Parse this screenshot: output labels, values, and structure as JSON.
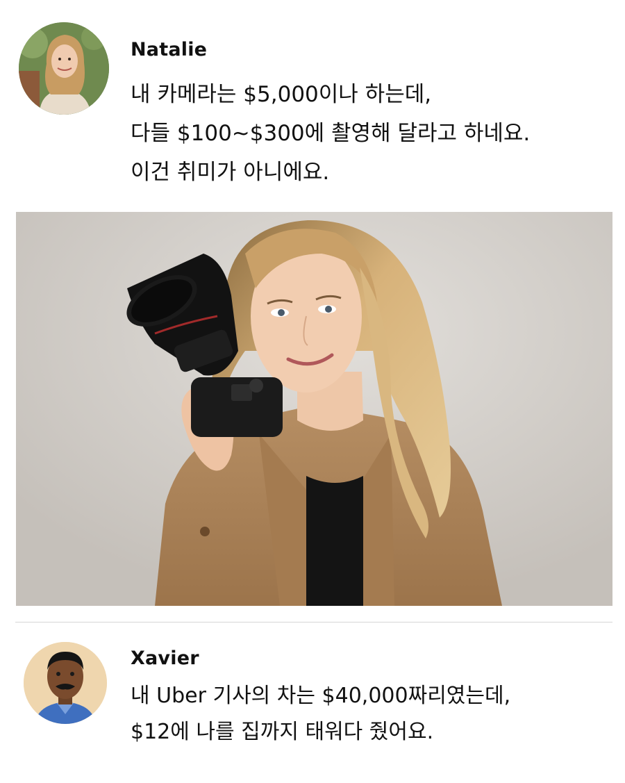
{
  "posts": [
    {
      "author": "Natalie",
      "avatar_icon": "avatar-photo",
      "message_lines": [
        "내 카메라는 $5,000이나 하는데,",
        "다들 $100~$300에 촬영해 달라고 하네요.",
        "이건 취미가 아니에요."
      ],
      "photo_icon": "photo-woman-with-camera"
    },
    {
      "author": "Xavier",
      "avatar_icon": "avatar-photo",
      "message_lines": [
        "내 Uber 기사의 차는 $40,000짜리였는데,",
        "$12에 나를 집까지 태워다 줬어요."
      ]
    }
  ],
  "colors": {
    "background": "#ffffff",
    "text": "#111111",
    "divider": "#d6d6d6",
    "jacket": "#b0885f"
  }
}
